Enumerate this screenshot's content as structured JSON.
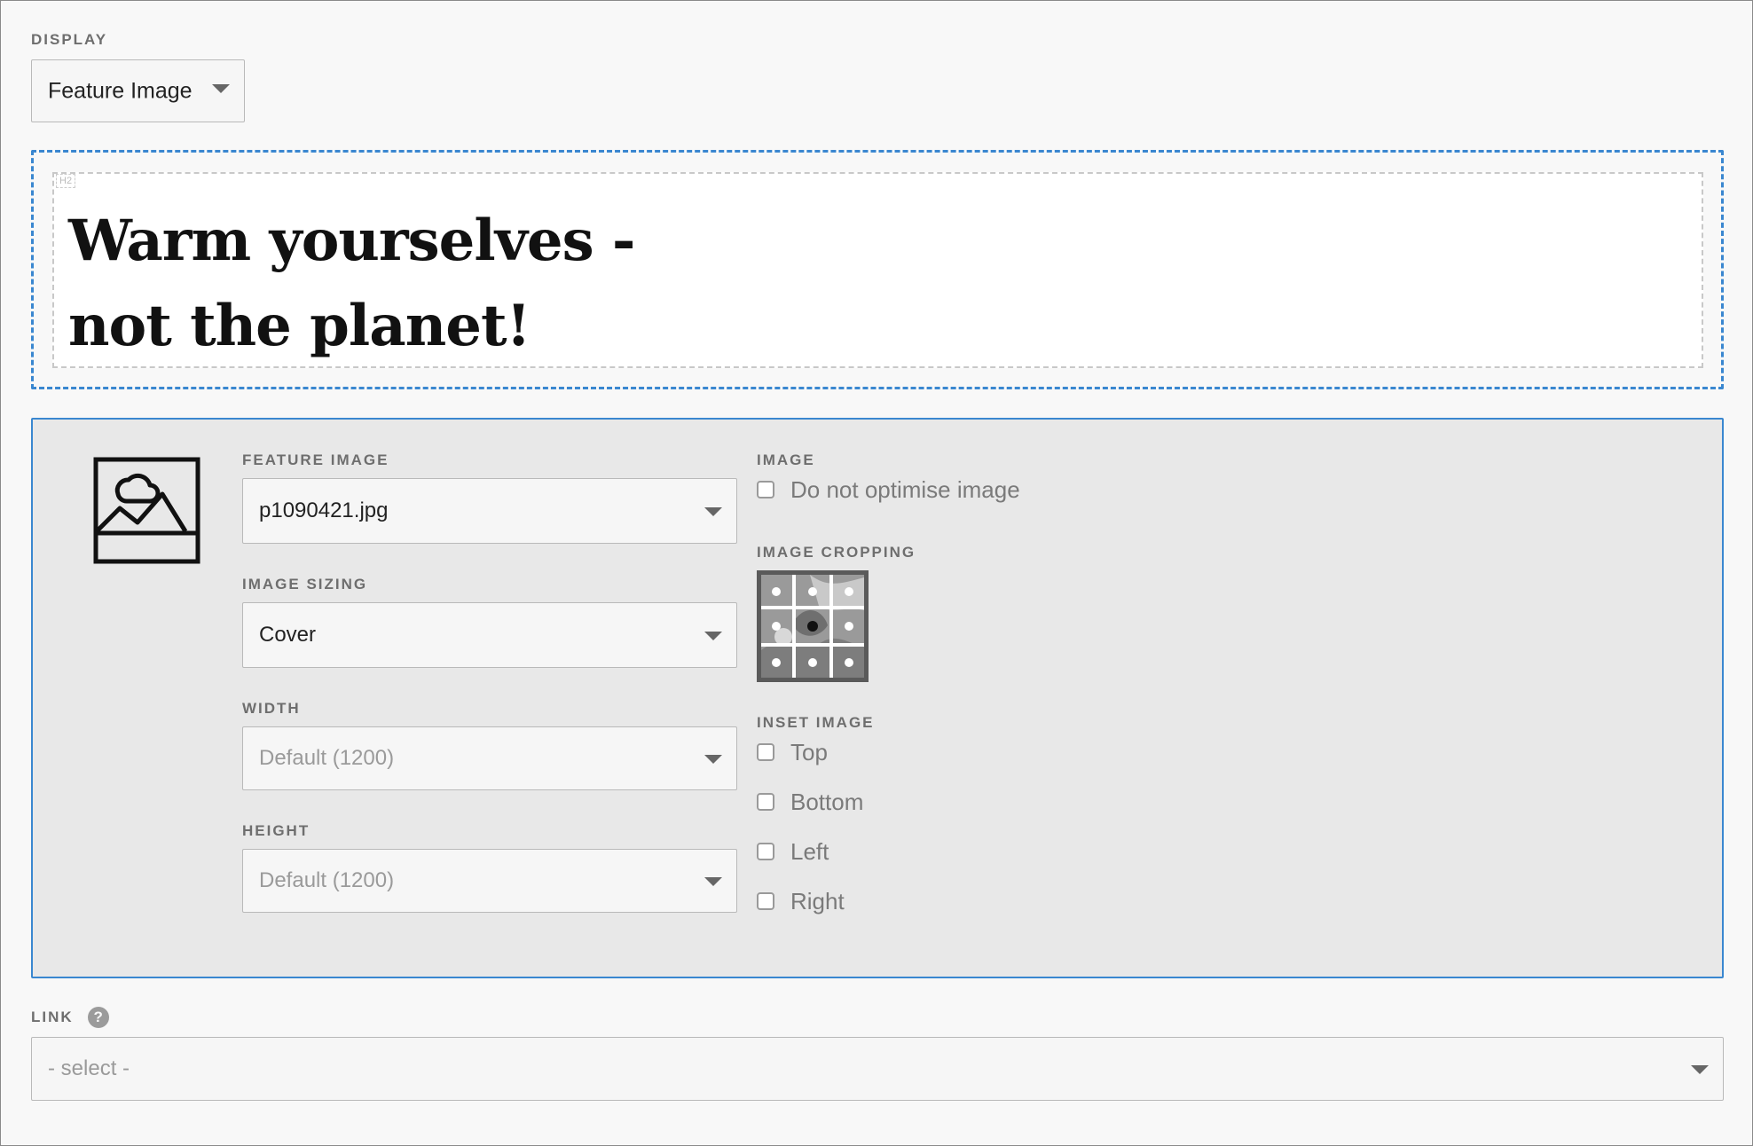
{
  "display": {
    "label": "DISPLAY",
    "selected": "Feature Image"
  },
  "heading_block": {
    "tag": "H2",
    "line1": "Warm yourselves -",
    "line2": "not the planet!"
  },
  "feature_panel": {
    "icon": "image-icon",
    "feature_image": {
      "label": "FEATURE IMAGE",
      "value": "p1090421.jpg"
    },
    "image_sizing": {
      "label": "IMAGE SIZING",
      "value": "Cover"
    },
    "width": {
      "label": "WIDTH",
      "placeholder": "Default (1200)"
    },
    "height": {
      "label": "HEIGHT",
      "placeholder": "Default (1200)"
    },
    "image": {
      "label": "IMAGE",
      "optimise_label": "Do not optimise image"
    },
    "cropping": {
      "label": "IMAGE CROPPING",
      "focal_point": "center"
    },
    "inset": {
      "label": "INSET IMAGE",
      "options": [
        "Top",
        "Bottom",
        "Left",
        "Right"
      ]
    }
  },
  "link": {
    "label": "LINK",
    "help_icon": "question-circle-icon",
    "placeholder": "- select -"
  },
  "colors": {
    "accent_dashed": "#3a87d0",
    "panel_bg": "#e8e8e8",
    "panel_border": "#3a87d0"
  }
}
